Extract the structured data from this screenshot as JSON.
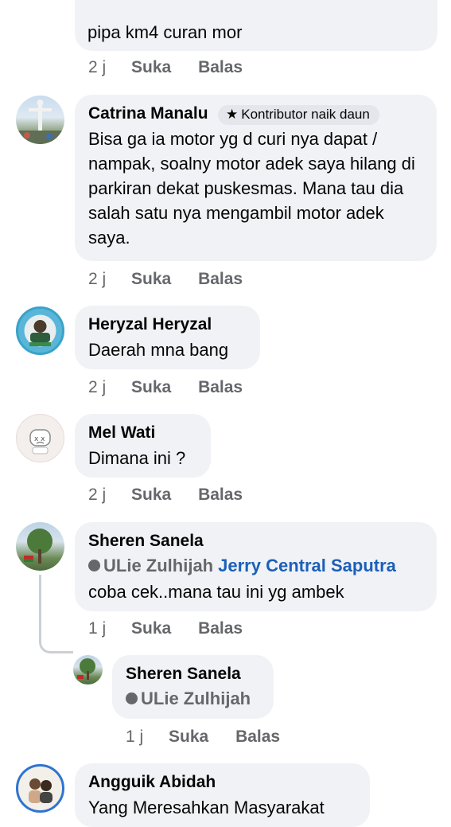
{
  "actions": {
    "like": "Suka",
    "reply": "Balas"
  },
  "comments": [
    {
      "text": "pipa km4 curan mor",
      "time": "2 j"
    },
    {
      "name": "Catrina Manalu",
      "badge": "Kontributor naik daun",
      "text": "Bisa ga ia motor yg d curi nya dapat / nampak, soalny motor adek saya hilang di parkiran dekat puskesmas. Mana tau dia salah satu nya mengambil motor adek saya.",
      "time": "2 j"
    },
    {
      "name": "Heryzal Heryzal",
      "text": "Daerah mna bang",
      "time": "2 j"
    },
    {
      "name": "Mel Wati",
      "text": "Dimana ini ?",
      "time": "2 j"
    },
    {
      "name": "Sheren Sanela",
      "tag_user": "ULie Zulhijah",
      "tag_link": "Jerry Central Saputra",
      "text": "coba cek..mana tau ini yg ambek",
      "time": "1 j"
    },
    {
      "name": "Sheren Sanela",
      "tag_user": "ULie Zulhijah",
      "time": "1 j"
    },
    {
      "name": "Angguik Abidah",
      "text": "Yang Meresahkan Masyarakat"
    }
  ]
}
